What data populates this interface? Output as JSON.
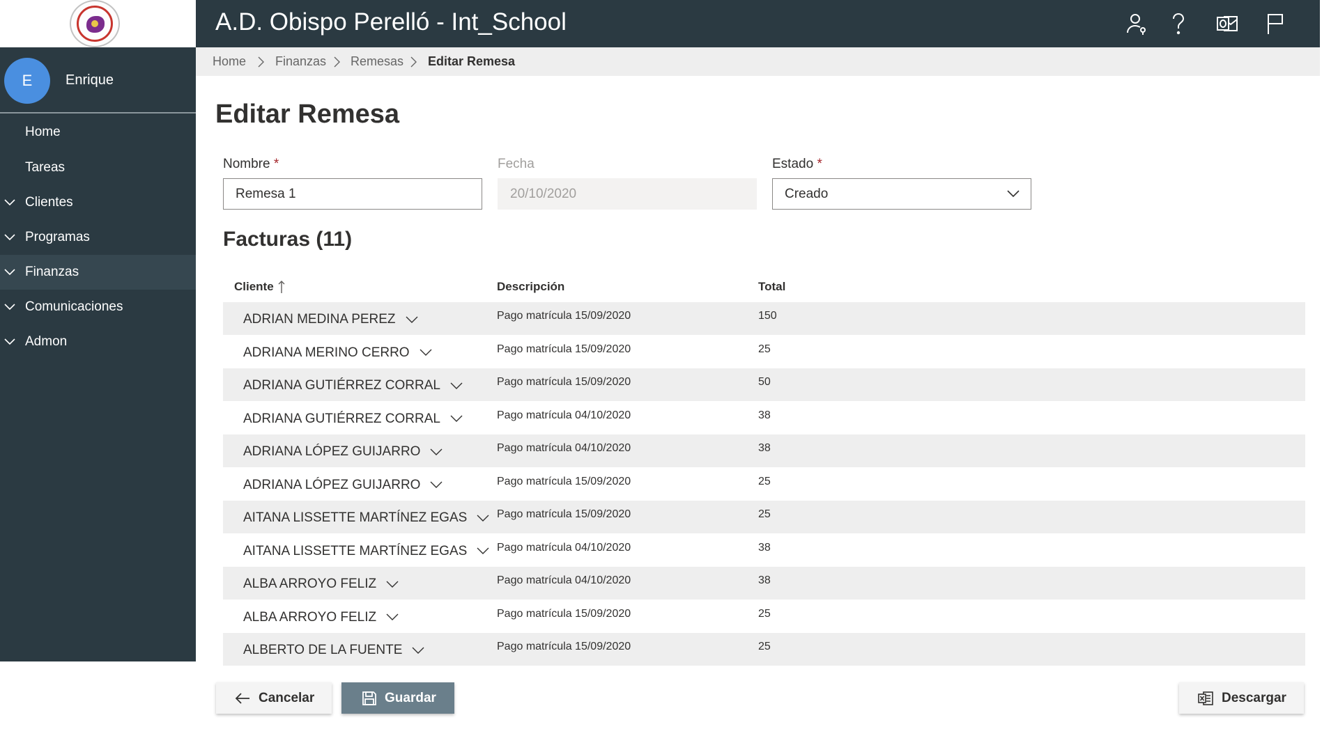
{
  "header": {
    "title": "A.D. Obispo Perelló - Int_School",
    "icons": [
      "person-key-icon",
      "help-icon",
      "outlook-icon",
      "flag-icon"
    ]
  },
  "user": {
    "initial": "E",
    "name": "Enrique"
  },
  "sidebar": {
    "items": [
      {
        "label": "Home",
        "expandable": false,
        "active": false
      },
      {
        "label": "Tareas",
        "expandable": false,
        "active": false
      },
      {
        "label": "Clientes",
        "expandable": true,
        "active": false
      },
      {
        "label": "Programas",
        "expandable": true,
        "active": false
      },
      {
        "label": "Finanzas",
        "expandable": true,
        "active": true
      },
      {
        "label": "Comunicaciones",
        "expandable": true,
        "active": false
      },
      {
        "label": "Admon",
        "expandable": true,
        "active": false
      }
    ]
  },
  "breadcrumb": [
    "Home",
    "Finanzas",
    "Remesas",
    "Editar Remesa"
  ],
  "page": {
    "title": "Editar Remesa"
  },
  "form": {
    "nombre": {
      "label": "Nombre",
      "required_mark": "*",
      "value": "Remesa 1"
    },
    "fecha": {
      "label": "Fecha",
      "value": "20/10/2020"
    },
    "estado": {
      "label": "Estado",
      "required_mark": "*",
      "value": "Creado"
    }
  },
  "facturas": {
    "title": "Facturas (11)",
    "columns": {
      "cliente": "Cliente",
      "descripcion": "Descripción",
      "total": "Total"
    },
    "rows": [
      {
        "cliente": "ADRIAN MEDINA PEREZ",
        "descripcion": "Pago matrícula 15/09/2020",
        "total": "150"
      },
      {
        "cliente": "ADRIANA MERINO CERRO",
        "descripcion": "Pago matrícula 15/09/2020",
        "total": "25"
      },
      {
        "cliente": "ADRIANA GUTIÉRREZ CORRAL",
        "descripcion": "Pago matrícula 15/09/2020",
        "total": "50"
      },
      {
        "cliente": "ADRIANA GUTIÉRREZ CORRAL",
        "descripcion": "Pago matrícula 04/10/2020",
        "total": "38"
      },
      {
        "cliente": "ADRIANA LÓPEZ GUIJARRO",
        "descripcion": "Pago matrícula 04/10/2020",
        "total": "38"
      },
      {
        "cliente": "ADRIANA LÓPEZ GUIJARRO",
        "descripcion": "Pago matrícula 15/09/2020",
        "total": "25"
      },
      {
        "cliente": "AITANA LISSETTE MARTÍNEZ EGAS",
        "descripcion": "Pago matrícula 15/09/2020",
        "total": "25"
      },
      {
        "cliente": "AITANA LISSETTE MARTÍNEZ EGAS",
        "descripcion": "Pago matrícula 04/10/2020",
        "total": "38"
      },
      {
        "cliente": "ALBA ARROYO FELIZ",
        "descripcion": "Pago matrícula 04/10/2020",
        "total": "38"
      },
      {
        "cliente": "ALBA ARROYO FELIZ",
        "descripcion": "Pago matrícula 15/09/2020",
        "total": "25"
      },
      {
        "cliente": "ALBERTO DE LA FUENTE",
        "descripcion": "Pago matrícula 15/09/2020",
        "total": "25"
      }
    ]
  },
  "actions": {
    "cancel_label": "Cancelar",
    "save_label": "Guardar",
    "download_label": "Descargar"
  },
  "colors": {
    "topbar": "#2b3a42",
    "sidebar": "#2b3a42",
    "avatar": "#4a8fe0",
    "primary_button": "#6a7f8b",
    "row_shade": "#eeeeee"
  }
}
